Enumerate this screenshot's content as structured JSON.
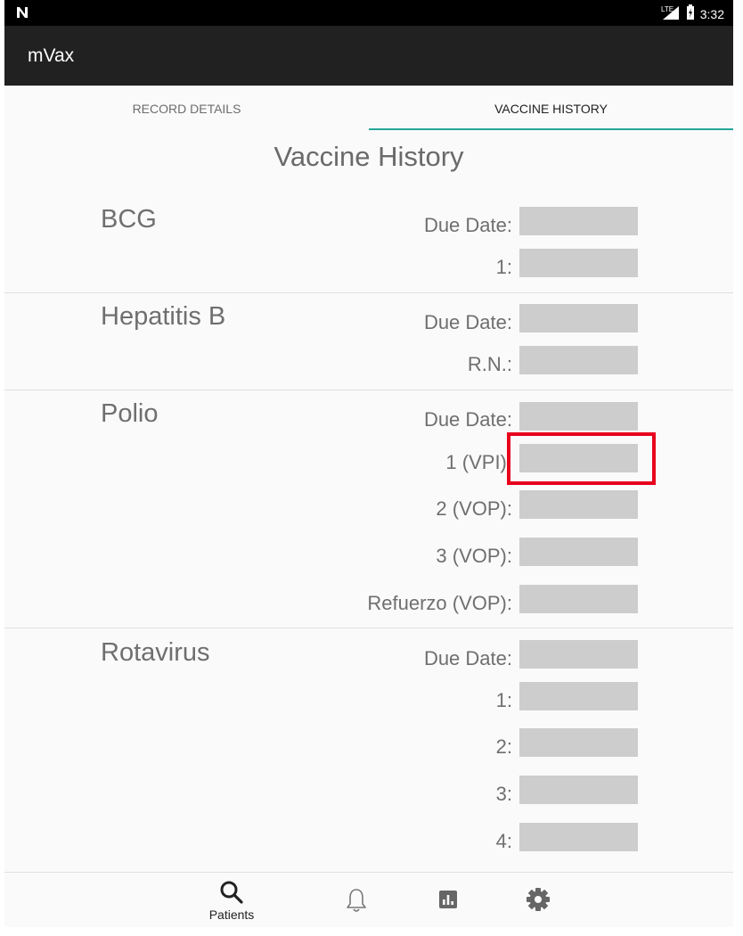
{
  "status_bar": {
    "time": "3:32",
    "network": "LTE",
    "notification_icon": "n-icon"
  },
  "app": {
    "title": "mVax"
  },
  "tabs": [
    {
      "label": "RECORD DETAILS",
      "selected": false
    },
    {
      "label": "VACCINE HISTORY",
      "selected": true
    }
  ],
  "page": {
    "title": "Vaccine History"
  },
  "vaccines": [
    {
      "name": "BCG",
      "fields": [
        {
          "label": "Due Date:",
          "value": ""
        },
        {
          "label": "1:",
          "value": ""
        }
      ]
    },
    {
      "name": "Hepatitis B",
      "fields": [
        {
          "label": "Due Date:",
          "value": ""
        },
        {
          "label": "R.N.:",
          "value": ""
        }
      ]
    },
    {
      "name": "Polio",
      "fields": [
        {
          "label": "Due Date:",
          "value": ""
        },
        {
          "label": "1 (VPI):",
          "value": ""
        },
        {
          "label": "2 (VOP):",
          "value": ""
        },
        {
          "label": "3 (VOP):",
          "value": ""
        },
        {
          "label": "Refuerzo (VOP):",
          "value": ""
        }
      ]
    },
    {
      "name": "Rotavirus",
      "fields": [
        {
          "label": "Due Date:",
          "value": ""
        },
        {
          "label": "1:",
          "value": ""
        },
        {
          "label": "2:",
          "value": ""
        },
        {
          "label": "3:",
          "value": ""
        },
        {
          "label": "4:",
          "value": ""
        }
      ]
    }
  ],
  "bottom_nav": [
    {
      "icon": "search-icon",
      "label": "Patients"
    },
    {
      "icon": "bell-icon",
      "label": ""
    },
    {
      "icon": "chart-icon",
      "label": ""
    },
    {
      "icon": "gear-icon",
      "label": ""
    }
  ],
  "colors": {
    "accent": "#26a69a",
    "toolbar": "#212121",
    "highlight": "#e8001c",
    "field": "#cdcdcd"
  }
}
